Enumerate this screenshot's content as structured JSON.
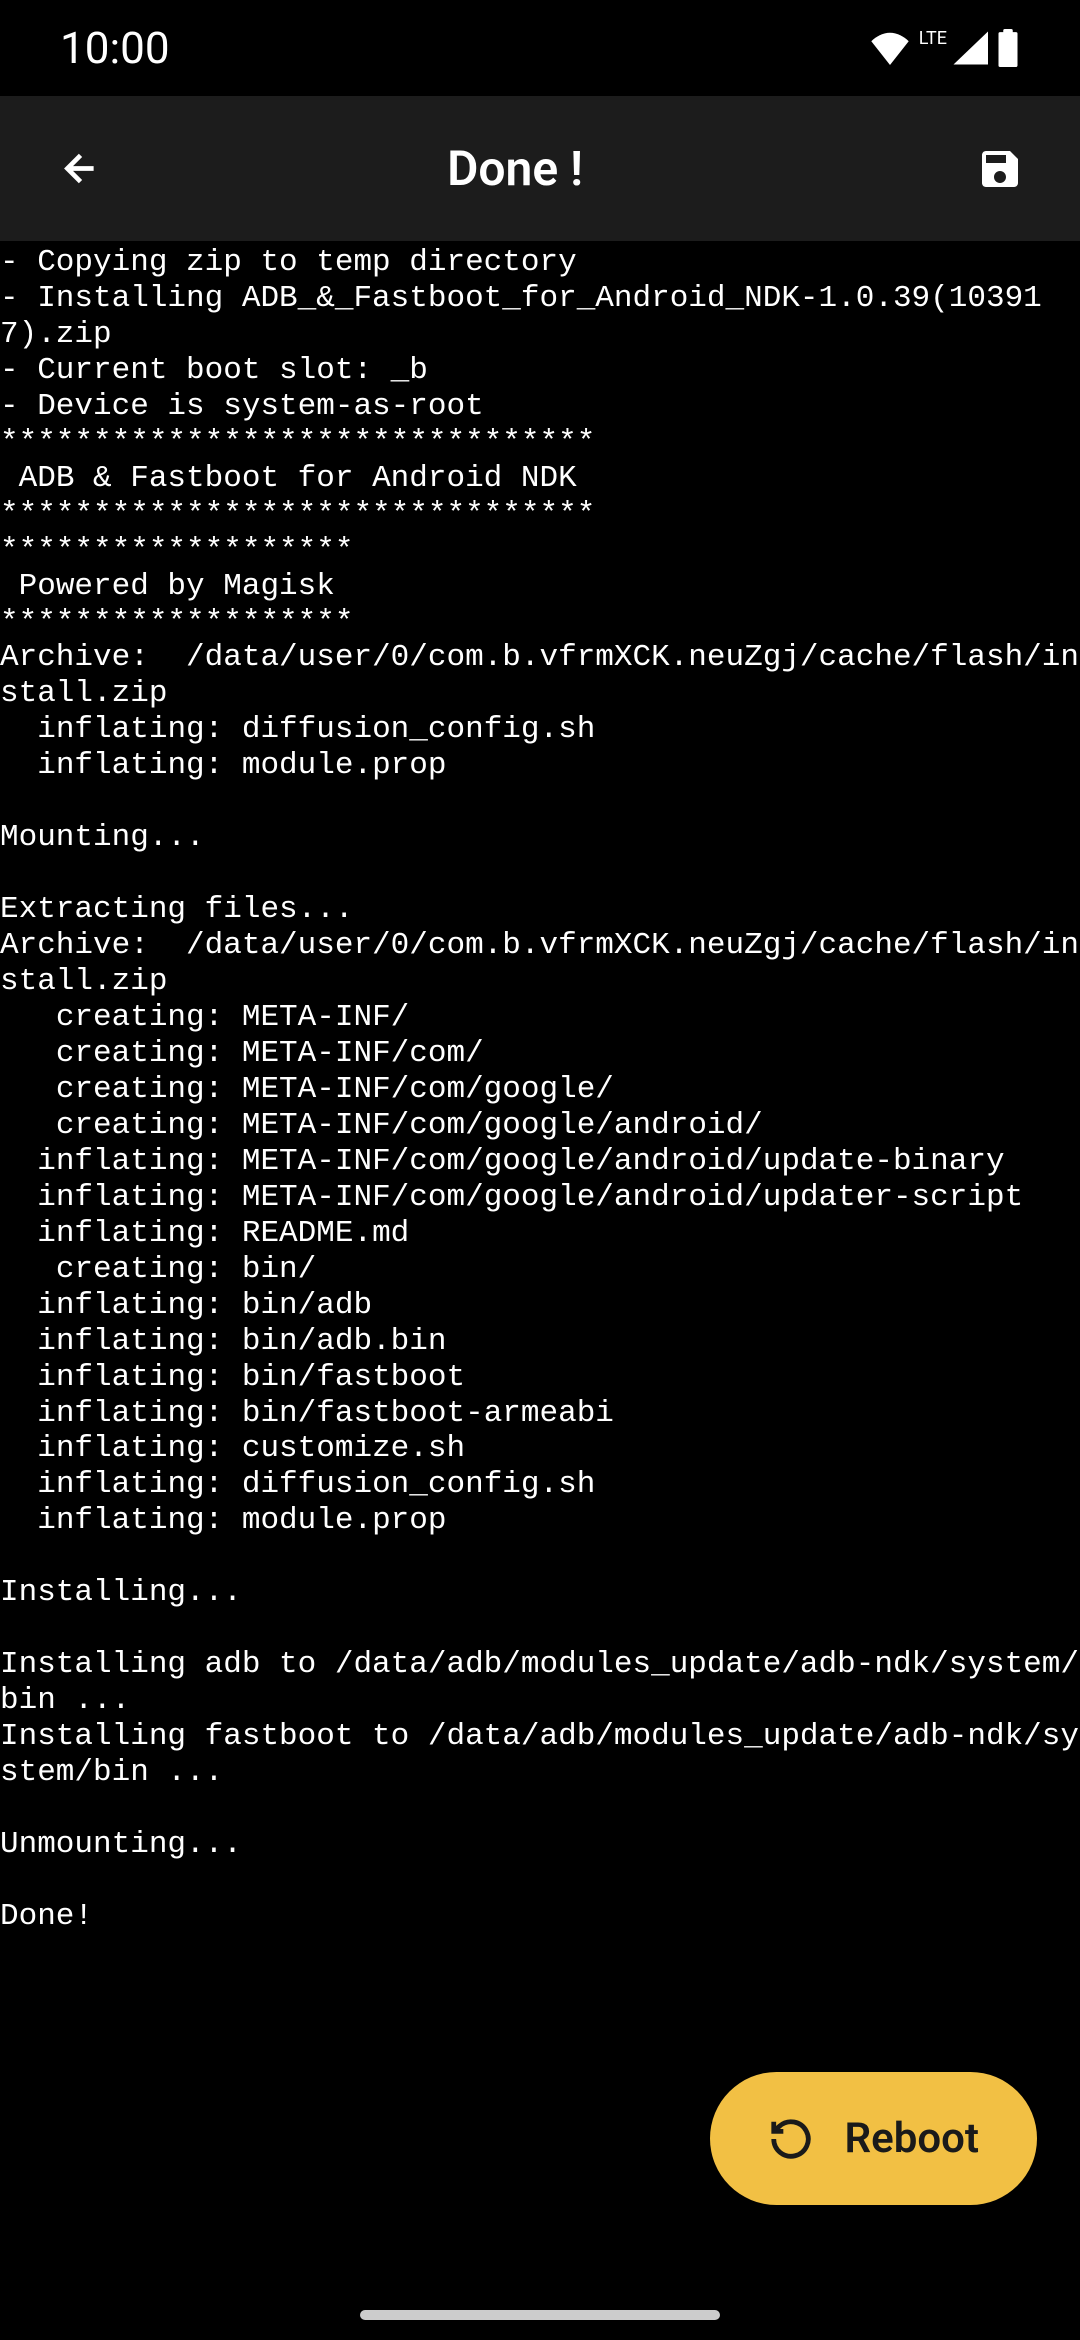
{
  "status_bar": {
    "time": "10:00",
    "lte": "LTE"
  },
  "app_bar": {
    "title": "Done !"
  },
  "terminal": {
    "lines": "- Copying zip to temp directory\n- Installing ADB_&_Fastboot_for_Android_NDK-1.0.39(103917).zip\n- Current boot slot: _b\n- Device is system-as-root\n********************************\n ADB & Fastboot for Android NDK\n********************************\n*******************\n Powered by Magisk\n*******************\nArchive:  /data/user/0/com.b.vfrmXCK.neuZgj/cache/flash/install.zip\n  inflating: diffusion_config.sh\n  inflating: module.prop\n\nMounting...\n\nExtracting files...\nArchive:  /data/user/0/com.b.vfrmXCK.neuZgj/cache/flash/install.zip\n   creating: META-INF/\n   creating: META-INF/com/\n   creating: META-INF/com/google/\n   creating: META-INF/com/google/android/\n  inflating: META-INF/com/google/android/update-binary\n  inflating: META-INF/com/google/android/updater-script\n  inflating: README.md\n   creating: bin/\n  inflating: bin/adb\n  inflating: bin/adb.bin\n  inflating: bin/fastboot\n  inflating: bin/fastboot-armeabi\n  inflating: customize.sh\n  inflating: diffusion_config.sh\n  inflating: module.prop\n\nInstalling...\n\nInstalling adb to /data/adb/modules_update/adb-ndk/system/bin ...\nInstalling fastboot to /data/adb/modules_update/adb-ndk/system/bin ...\n\nUnmounting...\n\nDone!"
  },
  "reboot_button": {
    "label": "Reboot"
  }
}
